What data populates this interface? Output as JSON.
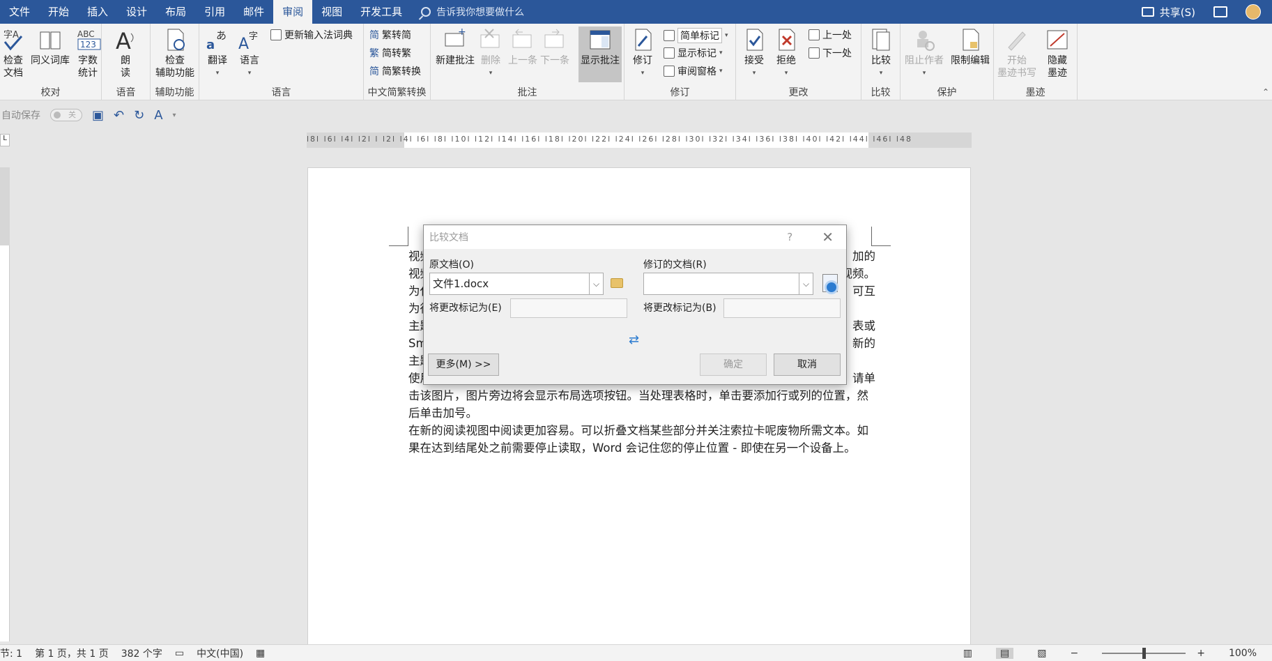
{
  "tabs": [
    "文件",
    "开始",
    "插入",
    "设计",
    "布局",
    "引用",
    "邮件",
    "审阅",
    "视图",
    "开发工具"
  ],
  "active_tab": "审阅",
  "tellme": "告诉我你想要做什么",
  "share": "共享(S)",
  "ribbon": {
    "proofing": {
      "label": "校对",
      "spell": "检查\n文档",
      "thesaurus": "同义词库",
      "wordcount": "字数\n统计"
    },
    "speech": {
      "label": "语音",
      "read": "朗\n读"
    },
    "accessibility": {
      "label": "辅助功能",
      "check": "检查\n辅助功能"
    },
    "language": {
      "label": "语言",
      "translate": "翻译",
      "lang": "语言",
      "update_ime": "更新输入法词典"
    },
    "chinese": {
      "label": "中文简繁转换",
      "t2s": "繁转简",
      "s2t": "简转繁",
      "convert": "简繁转换"
    },
    "comments": {
      "label": "批注",
      "new": "新建批注",
      "delete": "删除",
      "prev": "上一条",
      "next": "下一条",
      "show": "显示批注"
    },
    "tracking": {
      "label": "修订",
      "track": "修订",
      "simple_markup": "简单标记",
      "show_markup": "显示标记",
      "review_pane": "审阅窗格"
    },
    "changes": {
      "label": "更改",
      "accept": "接受",
      "reject": "拒绝",
      "prev": "上一处",
      "next": "下一处"
    },
    "compare": {
      "label": "比较",
      "compare": "比较"
    },
    "protect": {
      "label": "保护",
      "block": "阻止作者",
      "restrict": "限制编辑"
    },
    "ink": {
      "label": "墨迹",
      "start": "开始\n墨迹书写",
      "hide": "隐藏\n墨迹"
    }
  },
  "qat": {
    "autosave": "自动保存",
    "autosave_state": "关"
  },
  "ruler_numbers": "l8l l6l l4l l2l l l2l l4l l6l l8l l10l l12l l14l l16l l18l l20l l22l l24l l26l l28l l30l l32l l34l l36l l38l l40l l42l l44l l46l l48",
  "document": {
    "lines_right": [
      "加的",
      "视频。",
      "可互",
      "",
      "表或",
      "新的",
      "",
      "请单"
    ],
    "lines_left": [
      "视频",
      "视频",
      "为代",
      "为得",
      "主题",
      "Sm",
      "主题",
      "使用"
    ],
    "para2_tail": [
      "击该图片，图片旁边将会显示布局选项按钮。当处理表格时，单击要添加行或列的位置，然",
      "后单击加号。"
    ],
    "para3": [
      "在新的阅读视图中阅读更加容易。可以折叠文档某些部分并关注索拉卡呢废物所需文本。如",
      "果在达到结尾处之前需要停止读取，Word 会记住您的停止位置 - 即使在另一个设备上。"
    ]
  },
  "dialog": {
    "title": "比较文档",
    "help": "?",
    "original_label": "原文档(O)",
    "original_value": "文件1.docx",
    "revised_label": "修订的文档(R)",
    "revised_value": "",
    "mark_label_left": "将更改标记为(E)",
    "mark_label_right": "将更改标记为(B)",
    "more_button": "更多(M) >>",
    "ok_button": "确定",
    "cancel_button": "取消"
  },
  "status": {
    "section": "节: 1",
    "page": "第 1 页，共 1 页",
    "words": "382 个字",
    "language": "中文(中国)",
    "zoom": "100%"
  }
}
